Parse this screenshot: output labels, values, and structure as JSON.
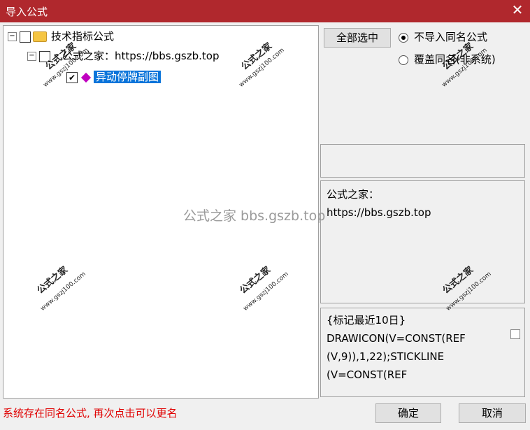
{
  "window": {
    "title": "导入公式"
  },
  "tree": {
    "root_label": "技术指标公式",
    "child_label": "公式之家：https://bbs.gszb.top",
    "leaf_label": "异动停牌副图",
    "leaf_check": "✔"
  },
  "options": {
    "select_all": "全部选中",
    "radio1": "不导入同名公式",
    "radio2": "覆盖同名(非系统)"
  },
  "description": {
    "line1": "公式之家：",
    "line2": "https://bbs.gszb.top"
  },
  "code": {
    "line1": "{标记最近10日}",
    "line2": "DRAWICON(V=CONST(REF",
    "line3": "(V,9)),1,22);STICKLINE",
    "line4": "(V=CONST(REF"
  },
  "status": "系统存在同名公式, 再次点击可以更名",
  "buttons": {
    "ok": "确定",
    "cancel": "取消"
  },
  "watermark": {
    "text": "公式之家",
    "site": "www.gszj100.com",
    "center": "公式之家 bbs.gszb.top"
  },
  "colors": {
    "titlebar": "#b0282d",
    "selection": "#0a74da",
    "status_text": "#e00000"
  }
}
